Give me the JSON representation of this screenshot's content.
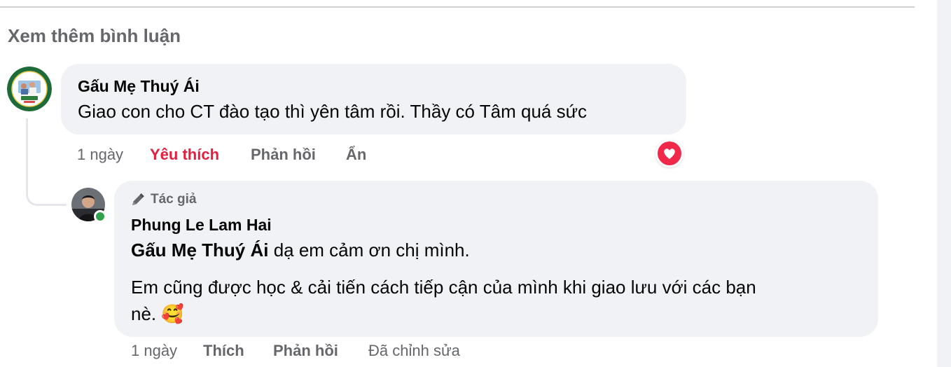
{
  "load_more": {
    "label": "Xem thêm bình luận"
  },
  "comment": {
    "author": "Gấu Mẹ Thuý Ái",
    "text": "Giao con cho CT đào tạo thì yên tâm rồi. Thầy có Tâm quá sức",
    "time": "1 ngày",
    "like_label": "Yêu thích",
    "reply_label": "Phản hồi",
    "hide_label": "Ẩn",
    "reaction": "heart-icon",
    "like_color": "#e41e3f"
  },
  "reply": {
    "badge": "Tác giả",
    "author": "Phung Le Lam Hai",
    "mention": "Gấu Mẹ Thuý Ái",
    "text_line1": " dạ em cảm ơn chị mình.",
    "text_line2": "Em cũng được học & cải tiến cách tiếp cận của mình khi giao lưu với các bạn",
    "text_line3": "nè. 🥰",
    "time": "1 ngày",
    "like_label": "Thích",
    "reply_label": "Phản hồi",
    "edited_label": "Đã chỉnh sửa",
    "online": true
  }
}
